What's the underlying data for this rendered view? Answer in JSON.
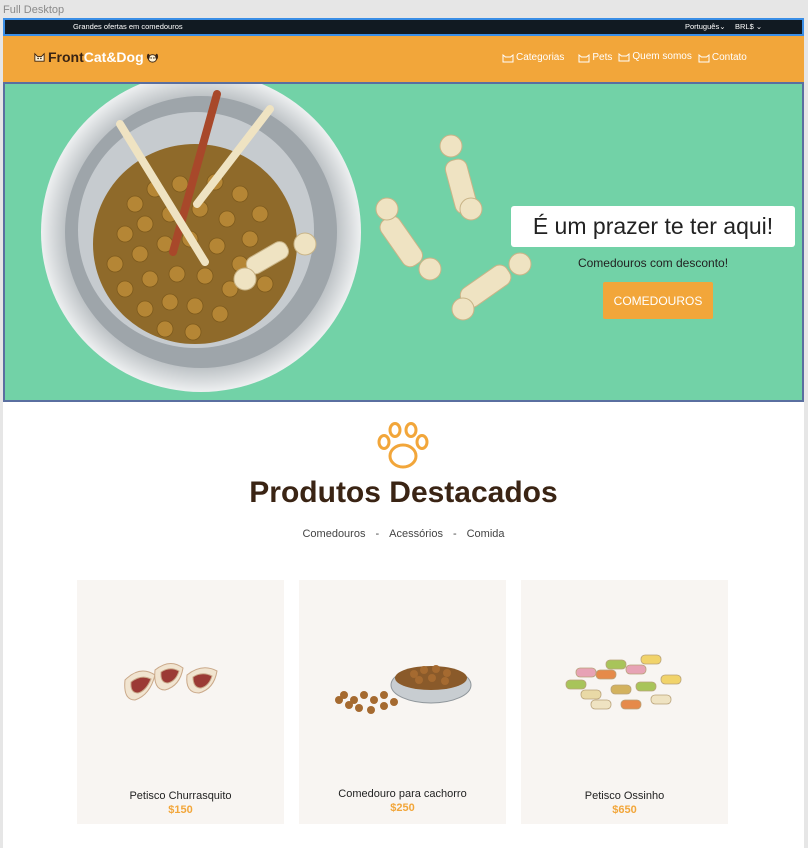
{
  "frame_label": "Full Desktop",
  "topbar": {
    "promo": "Grandes ofertas em comedouros",
    "language": "Português⌄",
    "currency": "BRL$  ⌄"
  },
  "nav": {
    "logo_part1": "Front",
    "logo_part2": "Cat&Dog",
    "items": [
      {
        "label": "Categorias"
      },
      {
        "label": "Pets"
      },
      {
        "label": "Quem somos"
      },
      {
        "label": "Contato"
      }
    ]
  },
  "hero": {
    "title": "É um prazer te ter aqui!",
    "subtitle": "Comedouros com desconto!",
    "button": "COMEDOUROS"
  },
  "featured": {
    "title": "Produtos Destacados",
    "filters": [
      "Comedouros",
      "Acessórios",
      "Comida"
    ],
    "sep": "-"
  },
  "products": [
    {
      "name": "Petisco Churrasquito",
      "price": "$150"
    },
    {
      "name": "Comedouro para cachorro",
      "price": "$250"
    },
    {
      "name": "Petisco Ossinho",
      "price": "$650"
    }
  ],
  "colors": {
    "brand_orange": "#f2a63a",
    "brand_brown": "#3a2414",
    "hero_green": "#72d2a7",
    "topbar_bg": "#111a22"
  }
}
